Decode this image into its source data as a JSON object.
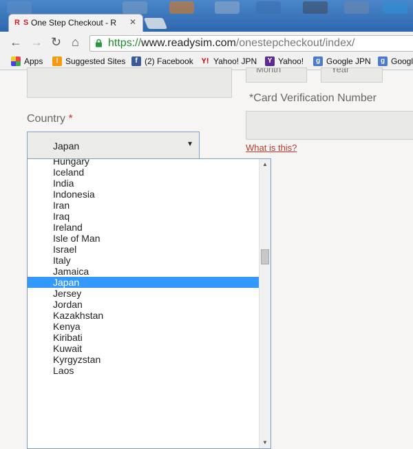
{
  "browser": {
    "tab_favicon": "R S",
    "tab_title": "One Step Checkout - Ready",
    "url_protocol": "https://",
    "url_host": "www.readysim.com",
    "url_path": "/onestepcheckout/index/",
    "bookmarks": [
      {
        "label": "Apps",
        "icon": "apps-grid-icon"
      },
      {
        "label": "Suggested Sites",
        "icon": "suggested-sites-icon"
      },
      {
        "label": "(2) Facebook",
        "icon": "facebook-icon"
      },
      {
        "label": "Yahoo! JPN",
        "icon": "yahoo-jp-icon"
      },
      {
        "label": "Yahoo!",
        "icon": "yahoo-icon"
      },
      {
        "label": "Google JPN",
        "icon": "google-icon"
      },
      {
        "label": "Googl",
        "icon": "google-icon"
      }
    ]
  },
  "form": {
    "month_label": "Month",
    "year_label": "Year",
    "country_label": "Country",
    "required_mark": "*",
    "country_value": "Japan",
    "cvn_label": "*Card Verification Number",
    "cvn_value": "",
    "what_is_this": "What is this?"
  },
  "dropdown": {
    "options": [
      "Hungary",
      "Iceland",
      "India",
      "Indonesia",
      "Iran",
      "Iraq",
      "Ireland",
      "Isle of Man",
      "Israel",
      "Italy",
      "Jamaica",
      "Japan",
      "Jersey",
      "Jordan",
      "Kazakhstan",
      "Kenya",
      "Kiribati",
      "Kuwait",
      "Kyrgyzstan",
      "Laos"
    ],
    "selected": "Japan",
    "accent": "#3399ff"
  }
}
